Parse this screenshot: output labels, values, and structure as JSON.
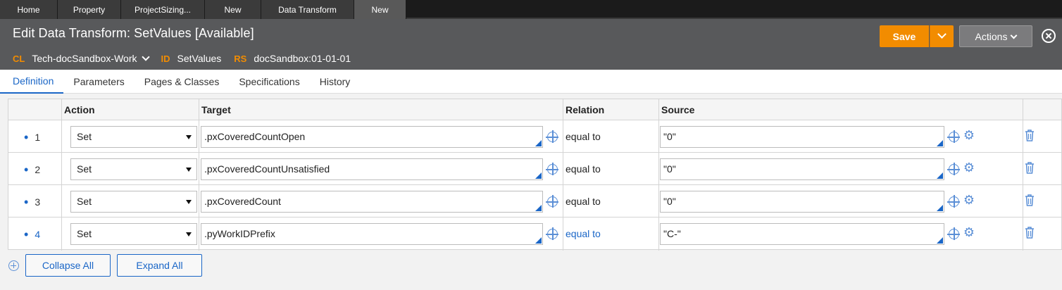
{
  "top_tabs": [
    {
      "label": "Home"
    },
    {
      "label": "Property"
    },
    {
      "label": "ProjectSizing..."
    },
    {
      "label": "New"
    },
    {
      "label": "Data Transform"
    },
    {
      "label": "New"
    }
  ],
  "header": {
    "title": "Edit Data Transform: SetValues [Available]",
    "cl_label": "CL",
    "cl_value": "Tech-docSandbox-Work",
    "id_label": "ID",
    "id_value": "SetValues",
    "rs_label": "RS",
    "rs_value": "docSandbox:01-01-01",
    "save_label": "Save",
    "actions_label": "Actions",
    "accent_color": "#f28c00"
  },
  "sub_tabs": [
    {
      "label": "Definition",
      "active": true
    },
    {
      "label": "Parameters"
    },
    {
      "label": "Pages & Classes"
    },
    {
      "label": "Specifications"
    },
    {
      "label": "History"
    }
  ],
  "table": {
    "columns": [
      "Action",
      "Target",
      "Relation",
      "Source"
    ],
    "rows": [
      {
        "num": "1",
        "action": "Set",
        "target": ".pxCoveredCountOpen",
        "relation": "equal to",
        "source": "\"0\""
      },
      {
        "num": "2",
        "action": "Set",
        "target": ".pxCoveredCountUnsatisfied",
        "relation": "equal to",
        "source": "\"0\""
      },
      {
        "num": "3",
        "action": "Set",
        "target": ".pxCoveredCount",
        "relation": "equal to",
        "source": "\"0\""
      },
      {
        "num": "4",
        "action": "Set",
        "target": ".pyWorkIDPrefix",
        "relation": "equal to",
        "source": "\"C-\""
      }
    ]
  },
  "footer": {
    "collapse_label": "Collapse All",
    "expand_label": "Expand All"
  }
}
